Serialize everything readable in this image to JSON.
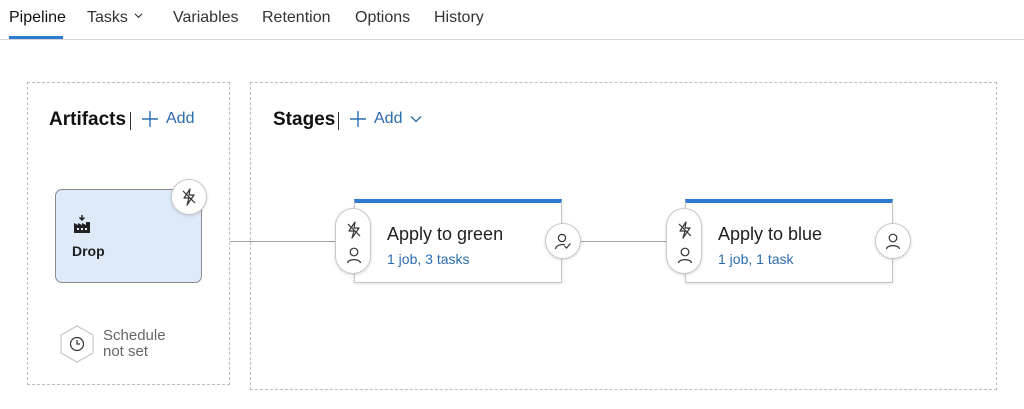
{
  "tabs": [
    {
      "label": "Pipeline",
      "active": true
    },
    {
      "label": "Tasks",
      "has_dropdown": true
    },
    {
      "label": "Variables"
    },
    {
      "label": "Retention"
    },
    {
      "label": "Options"
    },
    {
      "label": "History"
    }
  ],
  "artifacts": {
    "title": "Artifacts",
    "add_label": "Add",
    "items": [
      {
        "name": "Drop",
        "icon": "build-artifact-icon",
        "trigger_icon": "lightning-trigger-icon"
      }
    ],
    "schedule": {
      "line1": "Schedule",
      "line2": "not set",
      "icon": "clock-icon"
    }
  },
  "stages": {
    "title": "Stages",
    "add_label": "Add",
    "items": [
      {
        "name": "Apply to green",
        "summary": "1 job, 3 tasks",
        "pre_icons": [
          "lightning-trigger-icon",
          "person-icon"
        ],
        "post_icon": "person-check-icon"
      },
      {
        "name": "Apply to blue",
        "summary": "1 job, 1 task",
        "pre_icons": [
          "lightning-trigger-icon",
          "person-icon"
        ],
        "post_icon": "person-icon"
      }
    ]
  },
  "colors": {
    "accent": "#2b7bd0",
    "link": "#2b6cb0",
    "artifact_bg": "#deeaf8"
  }
}
